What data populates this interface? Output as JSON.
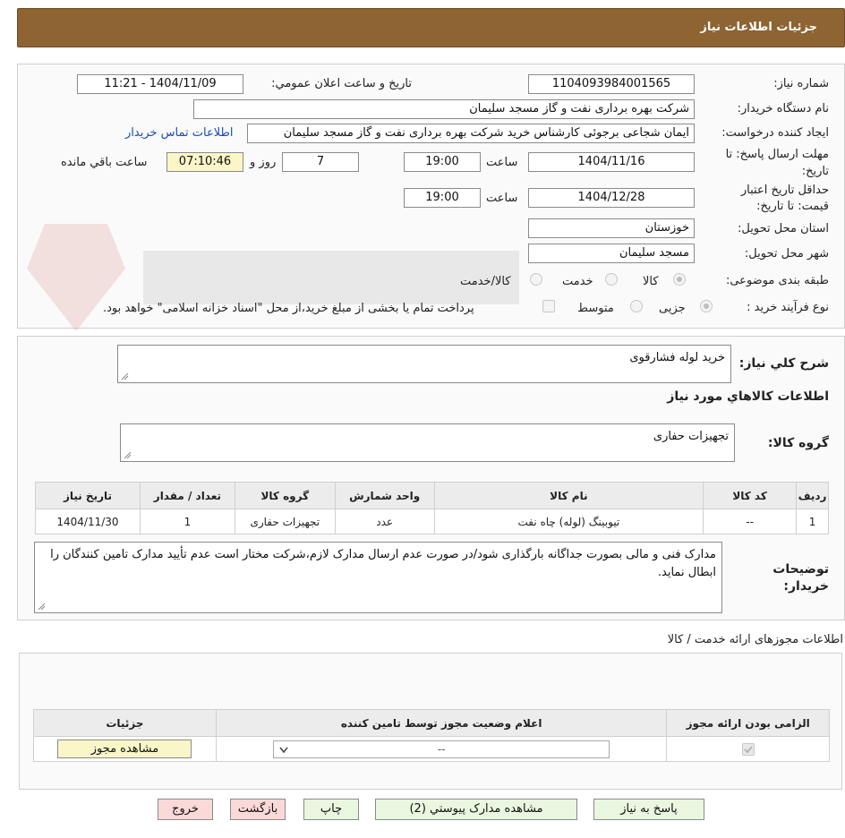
{
  "header": {
    "title": "جزئیات اطلاعات نیاز"
  },
  "form": {
    "need_number_label": "شماره نیاز:",
    "need_number": "1104093984001565",
    "announce_label": "تاریخ و ساعت اعلان عمومي:",
    "announce_value": "1404/11/09 - 11:21",
    "buyer_org_label": "نام دستگاه خريدار:",
    "buyer_org": "شرکت بهره برداری نفت و گاز مسجد سلیمان",
    "creator_label": "ايجاد کننده درخواست:",
    "creator": "ایمان شجاعی برجوئی کارشناس خرید شرکت بهره برداری نفت و گاز مسجد سلیمان",
    "contact_link": "اطلاعات تماس خريدار",
    "deadline_label_1": "مهلت ارسال پاسخ: تا",
    "deadline_label_2": "تاریخ:",
    "deadline_date": "1404/11/16",
    "time_label": "ساعت",
    "deadline_time": "19:00",
    "days_value": "7",
    "days_label": "روز و",
    "remaining_time": "07:10:46",
    "remaining_label": "ساعت باقي مانده",
    "validity_label_1": "حداقل تاریخ اعتبار",
    "validity_label_2": "قیمت: تا تاریخ:",
    "validity_date": "1404/12/28",
    "validity_time": "19:00",
    "province_label": "استان محل تحویل:",
    "province": "خوزستان",
    "city_label": "شهر محل تحویل:",
    "city": "مسجد سلیمان",
    "category_label": "طبقه بندی موضوعی:",
    "category_options": [
      "کالا",
      "خدمت",
      "کالا/خدمت"
    ],
    "process_label": "نوع فرآیند خرید :",
    "process_options": [
      "جزیی",
      "متوسط"
    ],
    "payment_note": "پرداخت تمام یا بخشی از مبلغ خرید،از محل \"اسناد خزانه اسلامی\" خواهد بود."
  },
  "description": {
    "label": "شرح کلي نياز:",
    "value": "خرید لوله فشارقوی"
  },
  "goods": {
    "section_title": "اطلاعات کالاهاي مورد نياز",
    "group_label": "گروه کالا:",
    "group_value": "تجهیزات حفاری",
    "columns": [
      "رديف",
      "کد کالا",
      "نام کالا",
      "واحد شمارش",
      "گروه کالا",
      "تعداد / مقدار",
      "تاريخ نياز"
    ],
    "rows": [
      [
        "1",
        "--",
        "تیوبینگ (لوله) چاه نفت",
        "عدد",
        "تجهیزات حفاری",
        "1",
        "1404/11/30"
      ]
    ]
  },
  "buyer_notes": {
    "label_1": "توضيحات",
    "label_2": "خريدار:",
    "value": "مدارک فنی و مالی بصورت جداگانه بارگذاری شود/در صورت عدم ارسال مدارک لازم،شرکت مختار است عدم تأیید مدارک تامین کنندگان را ابطال نماید."
  },
  "licenses": {
    "section_title": "اطلاعات مجوزهای ارائه خدمت / کالا",
    "columns": [
      "الزامی بودن ارائه مجوز",
      "اعلام وضعیت مجوز توسط تامین کننده",
      "جزئیات"
    ],
    "select_value": "--",
    "view_button": "مشاهده مجوز"
  },
  "buttons": {
    "reply": "پاسخ به نياز",
    "attachments": "مشاهده مدارک پيوستي (2)",
    "print": "چاپ",
    "back": "بازگشت",
    "exit": "خروج"
  },
  "colors": {
    "header_bg": "#8d6432",
    "link": "#1a4bb8",
    "highlight": "#fbf6c8",
    "btn_green": "#eaf7e0",
    "btn_red": "#fbd9d9"
  }
}
